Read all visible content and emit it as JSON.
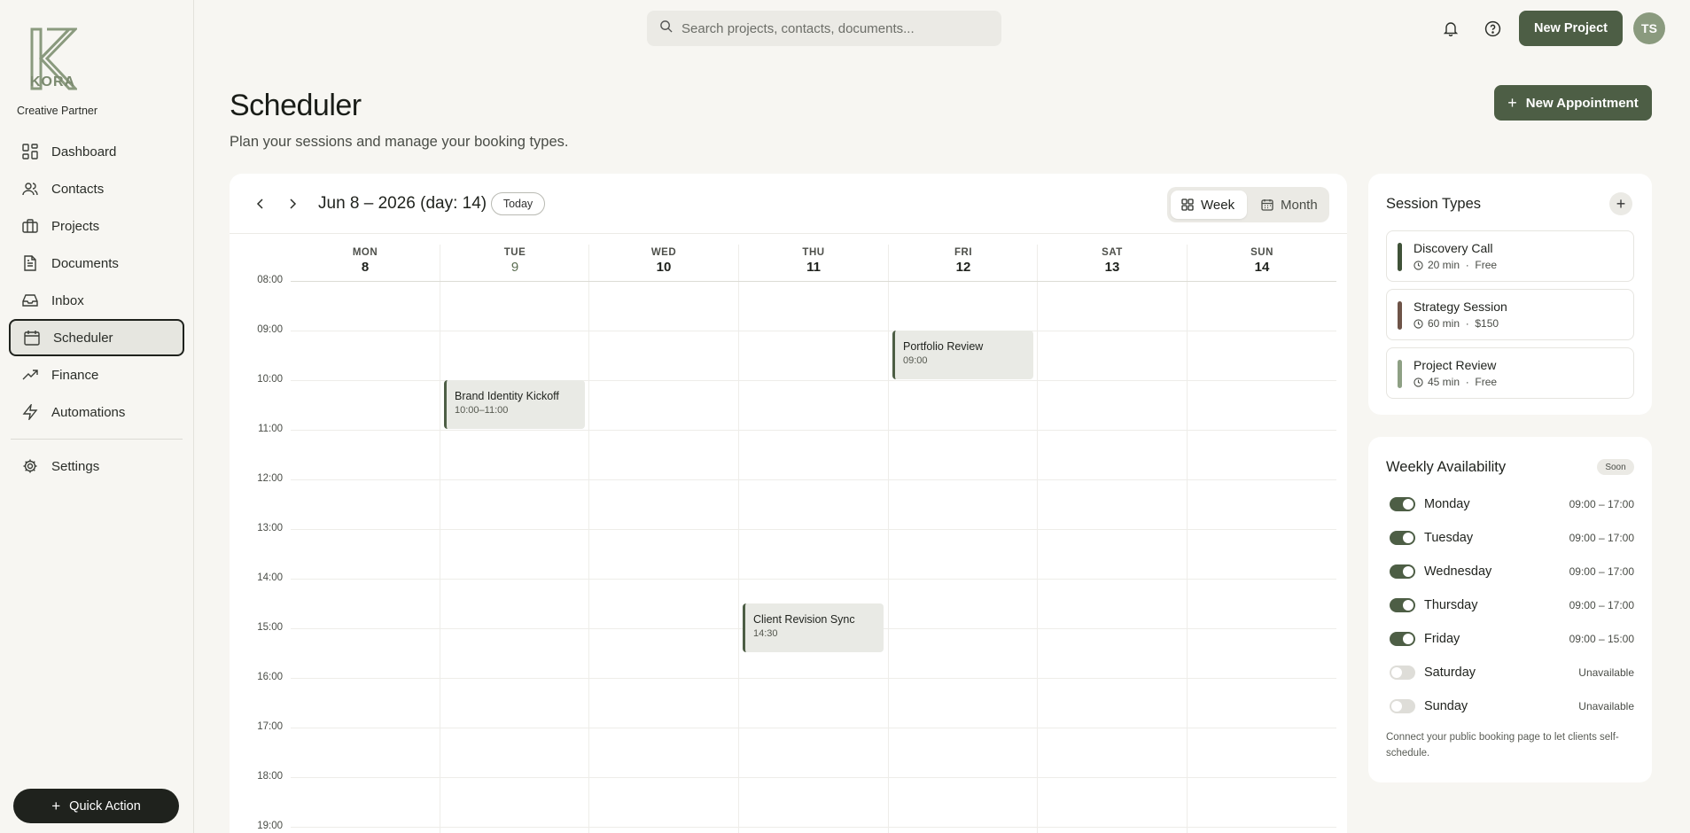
{
  "brand": {
    "logo_text": "KORA",
    "tagline": "Creative Partner"
  },
  "sidebar": {
    "items": [
      {
        "label": "Dashboard",
        "icon": "dashboard-icon"
      },
      {
        "label": "Contacts",
        "icon": "users-icon"
      },
      {
        "label": "Projects",
        "icon": "briefcase-icon"
      },
      {
        "label": "Documents",
        "icon": "document-icon"
      },
      {
        "label": "Inbox",
        "icon": "inbox-icon"
      },
      {
        "label": "Scheduler",
        "icon": "calendar-icon",
        "active": true
      },
      {
        "label": "Finance",
        "icon": "trending-icon"
      },
      {
        "label": "Automations",
        "icon": "bolt-icon"
      }
    ],
    "settings_label": "Settings",
    "quick_action_label": "Quick Action"
  },
  "topbar": {
    "search_placeholder": "Search projects, contacts, documents...",
    "new_project_label": "New Project",
    "avatar_initials": "TS"
  },
  "header": {
    "title": "Scheduler",
    "subtitle": "Plan your sessions and manage your booking types.",
    "new_appointment_label": "New Appointment"
  },
  "calendar": {
    "range_label": "Jun 8 – 2026 (day: 14)",
    "today_label": "Today",
    "view_week_label": "Week",
    "view_month_label": "Month",
    "active_view": "Week",
    "days": [
      {
        "name": "MON",
        "num": "8"
      },
      {
        "name": "TUE",
        "num": "9",
        "today": true
      },
      {
        "name": "WED",
        "num": "10"
      },
      {
        "name": "THU",
        "num": "11"
      },
      {
        "name": "FRI",
        "num": "12"
      },
      {
        "name": "SAT",
        "num": "13"
      },
      {
        "name": "SUN",
        "num": "14"
      }
    ],
    "hours": [
      "08:00",
      "09:00",
      "10:00",
      "11:00",
      "12:00",
      "13:00",
      "14:00",
      "15:00",
      "16:00",
      "17:00",
      "18:00",
      "19:00"
    ],
    "events": [
      {
        "title": "Brand Identity Kickoff",
        "time": "10:00–11:00",
        "day": "TUE"
      },
      {
        "title": "Portfolio Review",
        "time": "09:00",
        "day": "FRI"
      },
      {
        "title": "Client Revision Sync",
        "time": "14:30",
        "day": "THU"
      }
    ]
  },
  "session_types": {
    "title": "Session Types",
    "items": [
      {
        "title": "Discovery Call",
        "duration": "20 min",
        "price": "Free",
        "color": "#3f5238"
      },
      {
        "title": "Strategy Session",
        "duration": "60 min",
        "price": "$150",
        "color": "#6e5448"
      },
      {
        "title": "Project Review",
        "duration": "45 min",
        "price": "Free",
        "color": "#8ea084"
      }
    ]
  },
  "availability": {
    "title": "Weekly Availability",
    "badge": "Soon",
    "days": [
      {
        "day": "Monday",
        "hours": "09:00 – 17:00",
        "on": true
      },
      {
        "day": "Tuesday",
        "hours": "09:00 – 17:00",
        "on": true
      },
      {
        "day": "Wednesday",
        "hours": "09:00 – 17:00",
        "on": true
      },
      {
        "day": "Thursday",
        "hours": "09:00 – 17:00",
        "on": true
      },
      {
        "day": "Friday",
        "hours": "09:00 – 15:00",
        "on": true
      },
      {
        "day": "Saturday",
        "hours": "Unavailable",
        "on": false
      },
      {
        "day": "Sunday",
        "hours": "Unavailable",
        "on": false
      }
    ],
    "note": "Connect your public booking page to let clients self-schedule."
  },
  "colors": {
    "accent": "#4d5e45",
    "dark": "#1f221d",
    "background": "#f7f6f2"
  }
}
